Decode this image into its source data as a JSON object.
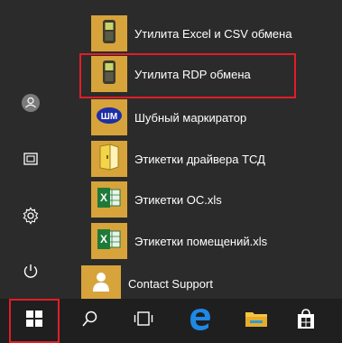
{
  "start_menu": {
    "apps": [
      {
        "label": "Утилита Excel и CSV обмена",
        "icon": "handheld-scanner-icon"
      },
      {
        "label": "Утилита RDP обмена",
        "icon": "handheld-scanner-icon"
      },
      {
        "label": "Шубный маркиратор",
        "icon": "shm-logo-icon",
        "badge": "ШМ"
      },
      {
        "label": "Этикетки драйвера ТСД",
        "icon": "document-folder-icon"
      },
      {
        "label": "Этикетки ОС.xls",
        "icon": "excel-icon",
        "badge": "X"
      },
      {
        "label": "Этикетки помещений.xls",
        "icon": "excel-icon",
        "badge": "X"
      },
      {
        "label": "Contact Support",
        "icon": "person-icon"
      }
    ],
    "rail": [
      "user-icon",
      "documents-icon",
      "settings-icon",
      "power-icon"
    ]
  },
  "taskbar": {
    "buttons": [
      "windows-start-icon",
      "search-icon",
      "task-view-icon",
      "edge-icon",
      "file-explorer-icon",
      "store-icon"
    ]
  },
  "colors": {
    "menu_bg": "#2b2b2b",
    "tile": "#d7a33b",
    "highlight": "#e11d26",
    "taskbar": "#1f1f1f"
  }
}
